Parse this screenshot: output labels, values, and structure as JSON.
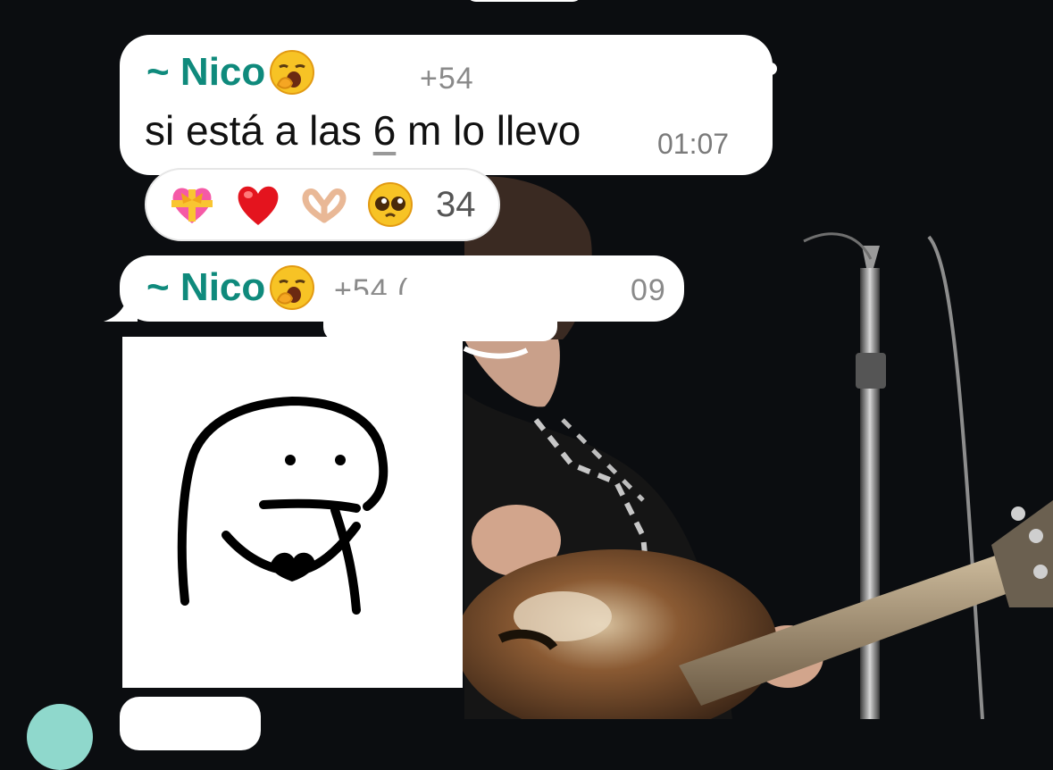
{
  "colors": {
    "sender_name": "#0f8a7c",
    "bubble": "#ffffff",
    "wallpaper": "#0b0d10",
    "time_text": "#7b7b7b"
  },
  "messages": [
    {
      "sender": "~ Nico",
      "sender_emoji": "yawning-face",
      "phone_fragment": "+54",
      "text_before": "si está a las ",
      "text_number": "6",
      "text_after": " m lo llevo",
      "time": "01:07",
      "reactions": {
        "emojis": [
          "heart-with-ribbon",
          "red-heart",
          "heart-hands",
          "pleading-face"
        ],
        "count": "34"
      }
    },
    {
      "sender": "~ Nico",
      "sender_emoji": "yawning-face",
      "phone_fragment": "+54 (",
      "phone_tail": "09",
      "type": "sticker",
      "sticker_icon": "blob-character-sticker"
    }
  ]
}
